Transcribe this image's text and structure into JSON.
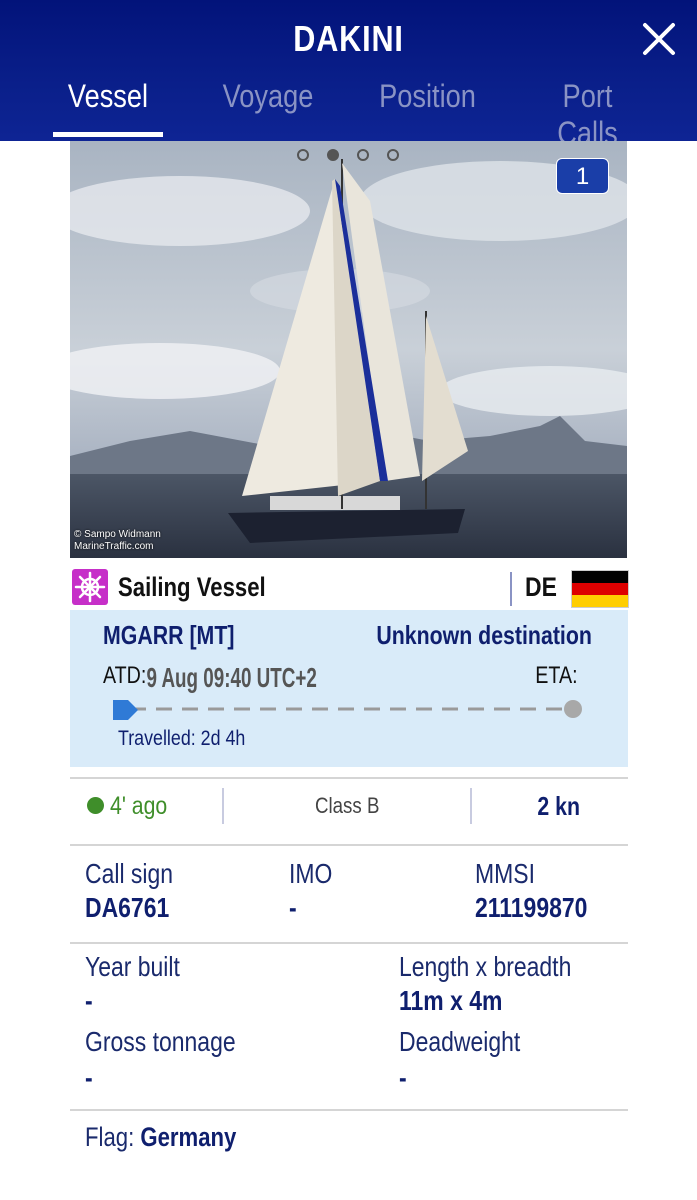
{
  "header": {
    "title": "DAKINI",
    "tabs": [
      {
        "label": "Vessel",
        "active": true
      },
      {
        "label": "Voyage",
        "active": false
      },
      {
        "label": "Position",
        "active": false
      },
      {
        "label": "Port Calls",
        "active": false
      }
    ],
    "close_icon": "close-icon"
  },
  "photo": {
    "count": "1",
    "credit_line1": "© Sampo Widmann",
    "credit_line2": "MarineTraffic.com",
    "carousel_dots": 4,
    "active_dot": 2
  },
  "vessel": {
    "type": "Sailing Vessel",
    "type_icon": "ship-wheel-icon",
    "type_color": "#c62fc8",
    "flag_code": "DE"
  },
  "voyage": {
    "from": "MGARR [MT]",
    "to": "Unknown destination",
    "atd_label": "ATD:",
    "atd_value": "9 Aug 09:40 UTC+2",
    "eta_label": "ETA:",
    "travelled": "Travelled: 2d 4h",
    "progress": 0.0
  },
  "status": {
    "ago": "4' ago",
    "class": "Class B",
    "speed": "2 kn",
    "live_color": "#3f8e2a"
  },
  "details": {
    "call_sign_label": "Call sign",
    "call_sign": "DA6761",
    "imo_label": "IMO",
    "imo": "-",
    "mmsi_label": "MMSI",
    "mmsi": "211199870",
    "year_built_label": "Year built",
    "year_built": "-",
    "length_label": "Length x breadth",
    "length": "11m x 4m",
    "gross_label": "Gross tonnage",
    "gross": "-",
    "deadweight_label": "Deadweight",
    "deadweight": "-",
    "flag_label": "Flag:",
    "flag": "Germany"
  },
  "colors": {
    "header": "#0a1f8a",
    "accent": "#0f1f6e",
    "voyage_bg": "#d9ebf9"
  }
}
